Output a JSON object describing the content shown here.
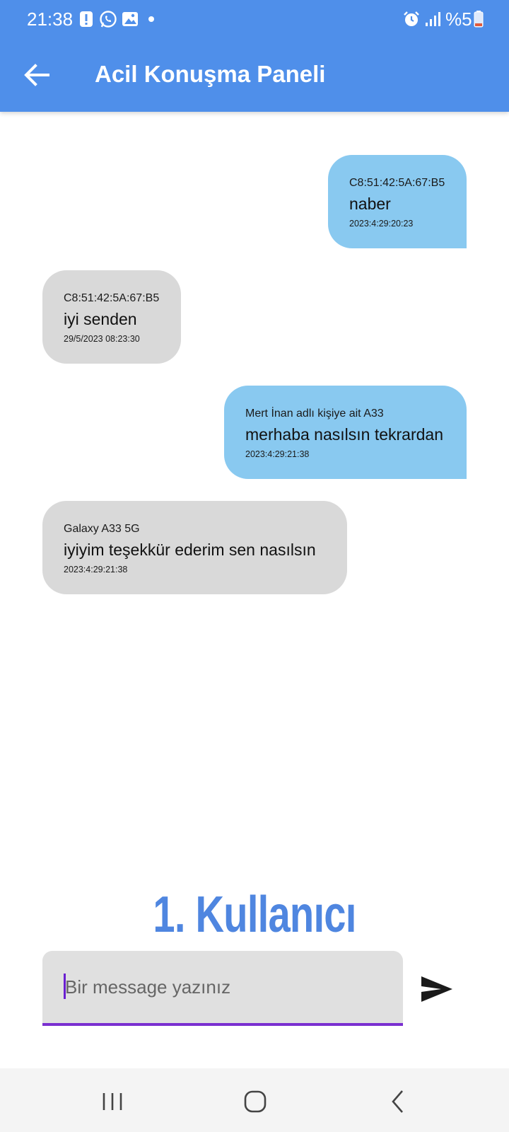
{
  "status_bar": {
    "time": "21:38",
    "left_icons": [
      "alert-icon",
      "whatsapp-icon",
      "gallery-icon",
      "dot-icon"
    ],
    "right_icons": [
      "alarm-icon",
      "signal-icon"
    ],
    "battery_text": "%5",
    "battery_color": "#e05a3c"
  },
  "app_bar": {
    "title": "Acil Konuşma Paneli",
    "back_icon": "arrow-back-icon",
    "color": "#4f8fea"
  },
  "messages": [
    {
      "direction": "sent",
      "sender": "C8:51:42:5A:67:B5",
      "text": "naber",
      "time": "2023:4:29:20:23"
    },
    {
      "direction": "received",
      "sender": "C8:51:42:5A:67:B5",
      "text": "iyi senden",
      "time": "29/5/2023 08:23:30"
    },
    {
      "direction": "sent",
      "sender": "Mert İnan adlı kişiye ait A33",
      "text": "merhaba nasılsın tekrardan",
      "time": "2023:4:29:21:38"
    },
    {
      "direction": "received",
      "sender": "Galaxy A33 5G",
      "text": "iyiyim teşekkür ederim sen nasılsın",
      "time": "2023:4:29:21:38"
    }
  ],
  "colors": {
    "sent_bubble": "#89c9f0",
    "received_bubble": "#d9d9d9",
    "caption": "#4f86e0",
    "input_underline": "#7a2fd0"
  },
  "caption": "1. Kullanıcı",
  "composer": {
    "placeholder": "Bir message yazınız",
    "send_icon": "send-icon"
  },
  "nav_bar": {
    "icons": [
      "recent-apps-icon",
      "home-icon",
      "back-icon"
    ]
  }
}
